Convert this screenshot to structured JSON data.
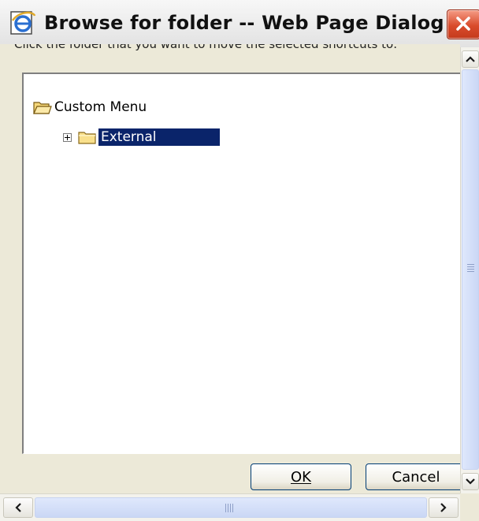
{
  "window": {
    "title": "Browse for folder -- Web Page Dialog",
    "instruction": "Click the folder that you want to move the selected shortcuts to:"
  },
  "tree": {
    "root": {
      "label": "Custom Menu",
      "icon": "folder-open-icon"
    },
    "children": [
      {
        "label": "External",
        "icon": "folder-icon",
        "expander": "plus",
        "selected": true
      }
    ]
  },
  "buttons": {
    "ok": "OK",
    "cancel": "Cancel"
  },
  "colors": {
    "selection": "#0a246a",
    "dialog_face": "#ece9d8",
    "close_button": "#d94b2b"
  }
}
